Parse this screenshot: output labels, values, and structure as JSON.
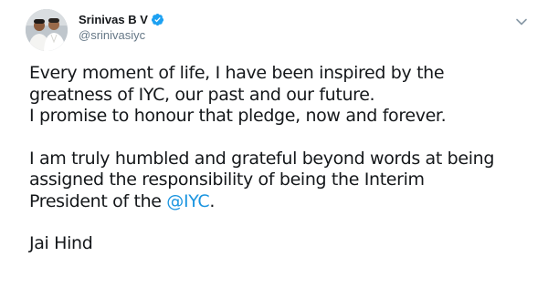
{
  "tweet": {
    "author": {
      "display_name": "Srinivas B V",
      "handle": "@srinivasiyc",
      "verified": true
    },
    "body": {
      "para1_line1": "Every moment of life, I have been inspired by the",
      "para1_line2": "greatness of IYC, our past and our future.",
      "para1_line3": "I promise to honour that pledge, now and forever.",
      "para2_line1": "I am truly humbled and grateful beyond words at being",
      "para2_line2": "assigned the responsibility of being the Interim",
      "para2_line3_prefix": "President of the ",
      "para2_mention": "@IYC",
      "para2_line3_suffix": ".",
      "para3": "Jai Hind"
    }
  },
  "icons": {
    "verified": "verified-badge-icon",
    "caret": "chevron-down-icon"
  },
  "colors": {
    "accent": "#1b95e0",
    "text": "#14171a",
    "muted": "#657786",
    "verified": "#1da1f2"
  }
}
